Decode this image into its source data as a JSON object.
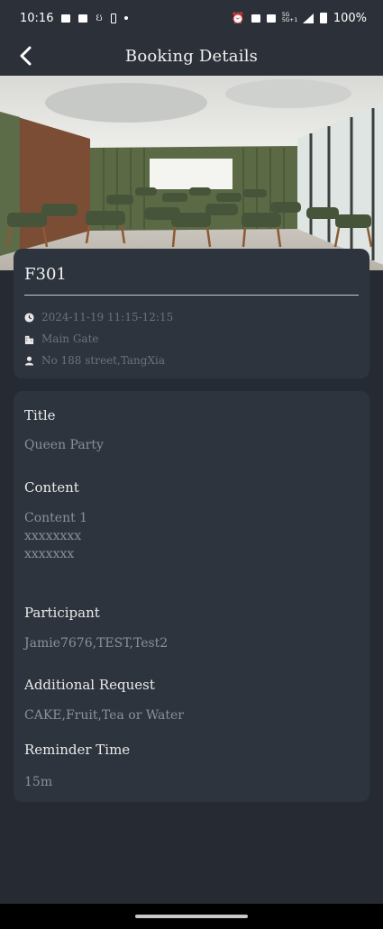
{
  "status_bar": {
    "time": "10:16",
    "signal_label": "5G 5G+1",
    "battery": "100%"
  },
  "header": {
    "title": "Booking Details"
  },
  "booking": {
    "room": "F301",
    "datetime": "2024-11-19 11:15-12:15",
    "building": "Main Gate",
    "address": "No 188 street,TangXia"
  },
  "details": {
    "title_label": "Title",
    "title_value": "Queen Party",
    "content_label": "Content",
    "content_lines": [
      "Content 1",
      "xxxxxxxx",
      "xxxxxxx"
    ],
    "participant_label": "Participant",
    "participant_value": "Jamie7676,TEST,Test2",
    "request_label": "Additional Request",
    "request_value": "CAKE,Fruit,Tea or Water",
    "reminder_label": "Reminder Time",
    "reminder_value": "15m"
  },
  "colors": {
    "background": "#262b33",
    "card": "#2e343d",
    "muted_text": "#8b9098"
  },
  "icons": {
    "back": "back-arrow-icon",
    "time": "clock-icon",
    "building": "building-icon",
    "address": "person-icon"
  }
}
